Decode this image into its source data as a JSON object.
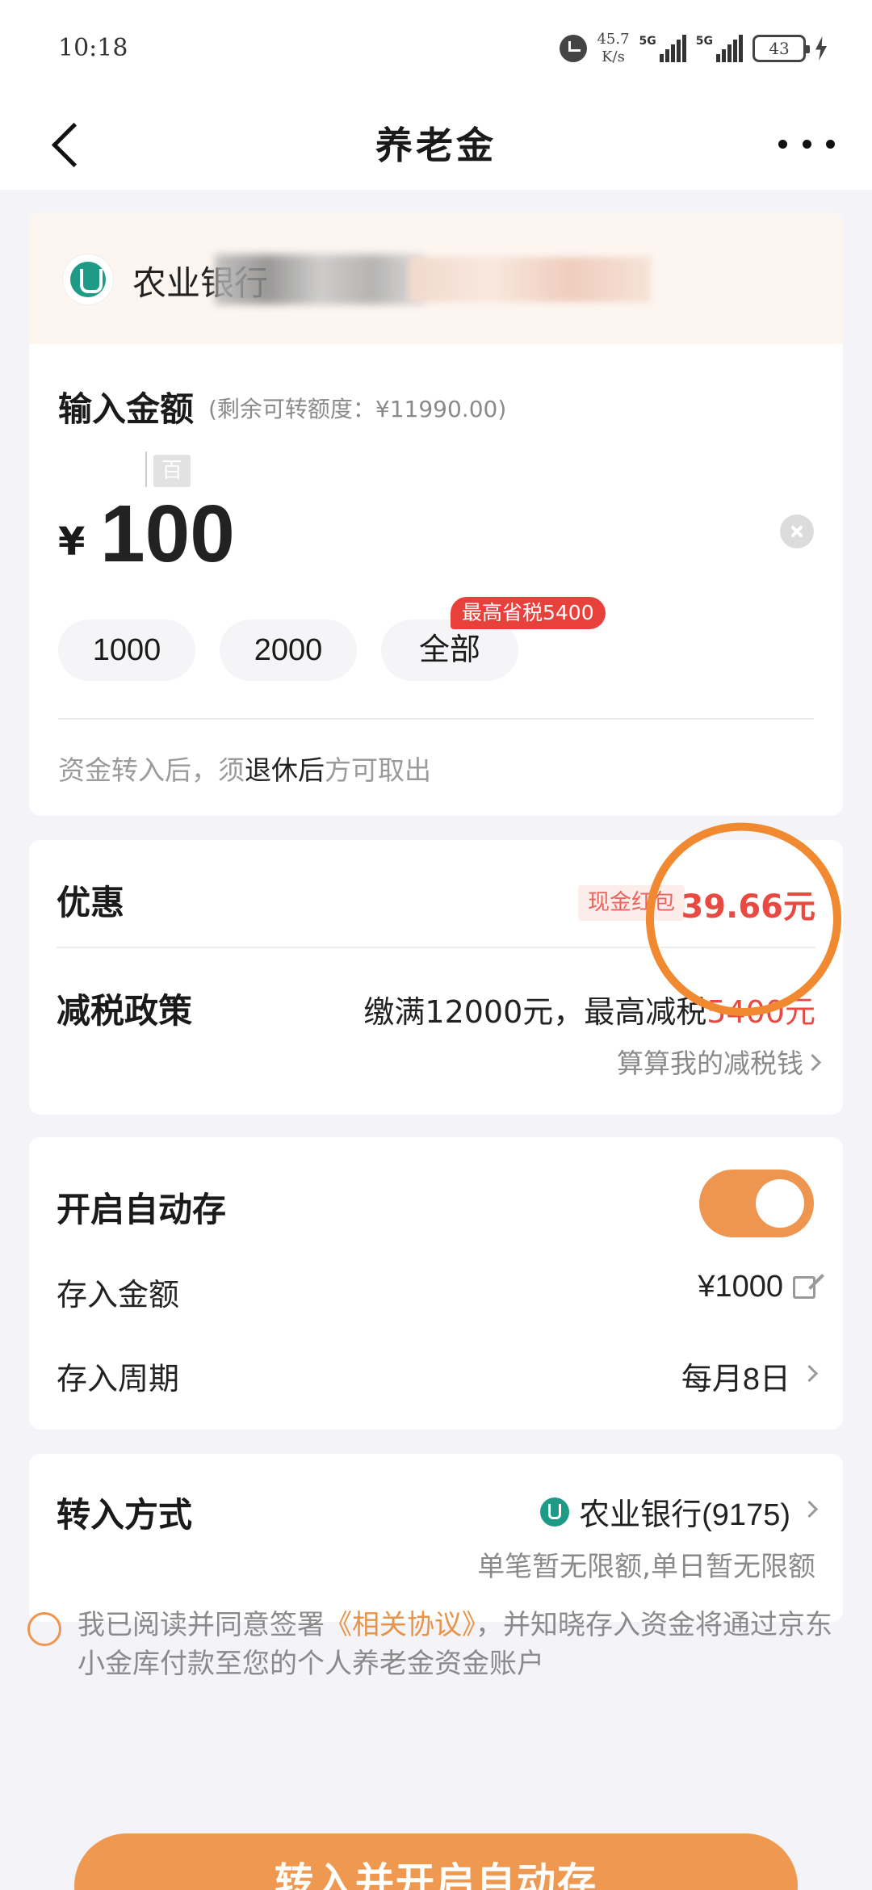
{
  "status_bar": {
    "time": "10:18",
    "net_speed_value": "45.7",
    "net_speed_unit": "K/s",
    "sim1": "5G",
    "sim2": "5G",
    "battery": "43"
  },
  "nav": {
    "title": "养老金"
  },
  "bank": {
    "name": "农业银行"
  },
  "amount": {
    "label": "输入金额",
    "hint": "(剩余可转额度：¥11990.00)",
    "unit_tag": "百",
    "currency": "¥",
    "value": "100",
    "quick_options": [
      "1000",
      "2000",
      "全部"
    ],
    "save_badge": "最高省税5400",
    "notice_prefix": "资金转入后，须",
    "notice_emphasis": "退休后",
    "notice_suffix": "方可取出"
  },
  "discount": {
    "title": "优惠",
    "tag": "现金红包",
    "value": "39.66元",
    "policy_title": "减税政策",
    "policy_text": "缴满12000元，最高减税",
    "policy_value": "5400元",
    "calc_link": "算算我的减税钱"
  },
  "auto_deposit": {
    "title": "开启自动存",
    "enabled": true,
    "amount_label": "存入金额",
    "amount_value": "¥1000",
    "period_label": "存入周期",
    "period_value": "每月8日"
  },
  "transfer": {
    "title": "转入方式",
    "bank": "农业银行(9175)",
    "limit": "单笔暂无限额,单日暂无限额"
  },
  "agreement": {
    "prefix": "我已阅读并同意签署",
    "link": "《相关协议》",
    "suffix": "，并知晓存入资金将通过京东小金库付款至您的个人养老金资金账户"
  },
  "submit": {
    "label": "转入并开启自动存"
  },
  "colors": {
    "accent": "#ef9850",
    "red": "#e84a42",
    "bank_green": "#1e9a86"
  }
}
